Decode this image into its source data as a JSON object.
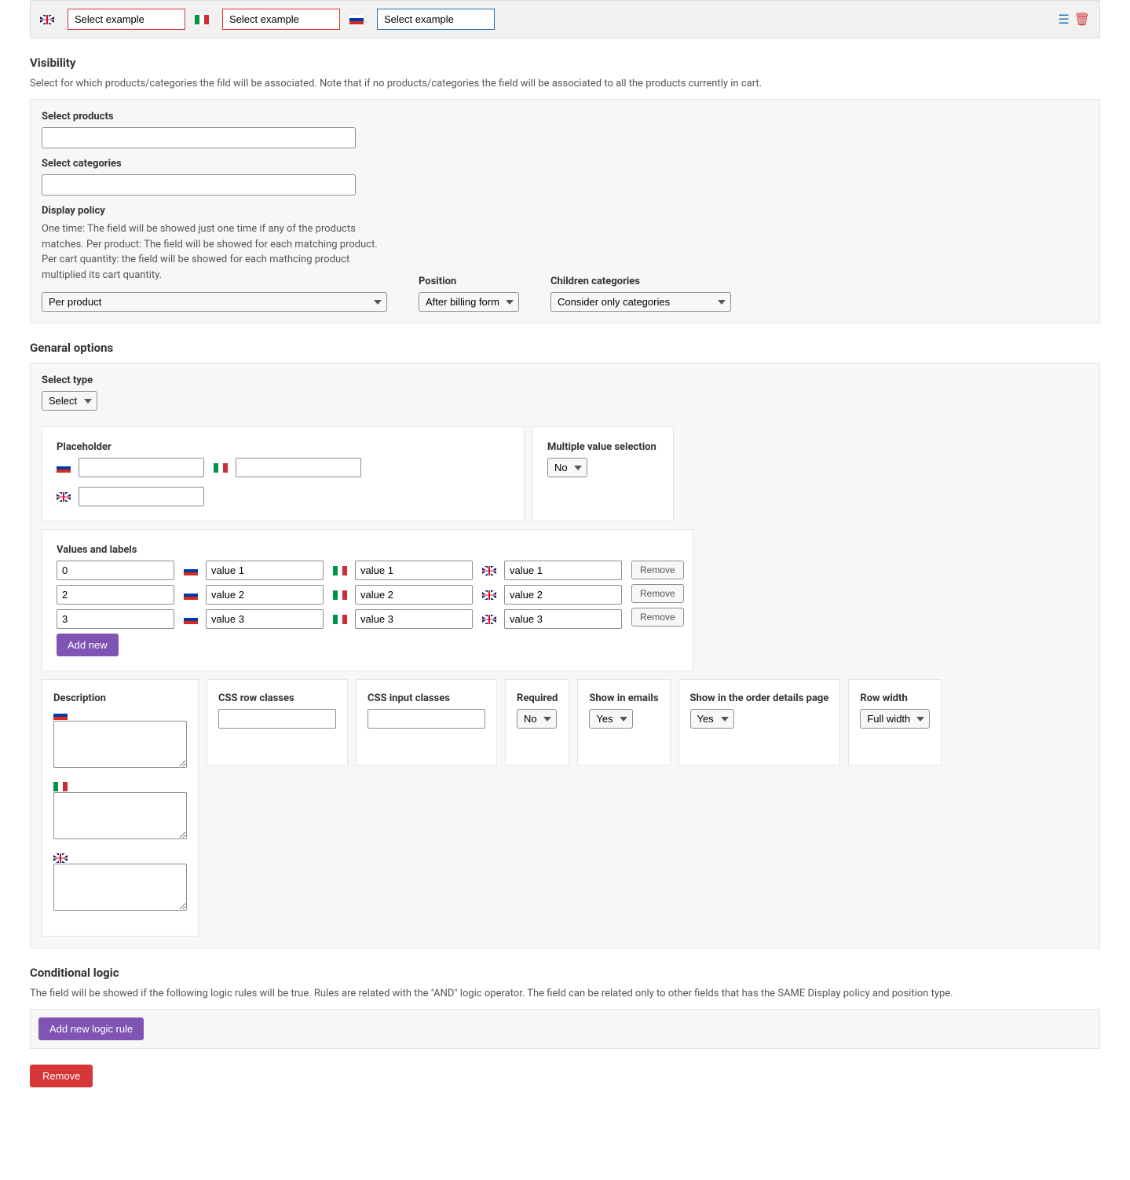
{
  "topbar": {
    "uk": "Select example",
    "it": "Select example",
    "ru": "Select example"
  },
  "visibility": {
    "heading": "Visibility",
    "desc": "Select for which products/categories the fild will be associated. Note that if no products/categories the field will be associated to all the products currently in cart.",
    "select_products": "Select products",
    "select_categories": "Select categories",
    "display_policy": "Display policy",
    "policy_desc": "One time: The field will be showed just one time if any of the products matches. Per product: The field will be showed for each matching product. Per cart quantity: the field will be showed for each mathcing product multiplied its cart quantity.",
    "policy_value": "Per product",
    "position_label": "Position",
    "position_value": "After billing form",
    "children_label": "Children categories",
    "children_value": "Consider only categories"
  },
  "general": {
    "heading": "Genaral options",
    "select_type_label": "Select type",
    "select_type_value": "Select",
    "placeholder_label": "Placeholder",
    "multiple_label": "Multiple value selection",
    "multiple_value": "No",
    "values_labels": "Values and labels",
    "rows": [
      {
        "num": "0",
        "ru": "value 1",
        "it": "value 1",
        "uk": "value 1"
      },
      {
        "num": "2",
        "ru": "value 2",
        "it": "value 2",
        "uk": "value 2"
      },
      {
        "num": "3",
        "ru": "value 3",
        "it": "value 3",
        "uk": "value 3"
      }
    ],
    "remove": "Remove",
    "add_new": "Add new",
    "description_label": "Description",
    "css_row": "CSS row classes",
    "css_input": "CSS input classes",
    "required_label": "Required",
    "required_value": "No",
    "emails_label": "Show in emails",
    "emails_value": "Yes",
    "order_label": "Show in the order details page",
    "order_value": "Yes",
    "row_width_label": "Row width",
    "row_width_value": "Full width"
  },
  "conditional": {
    "heading": "Conditional logic",
    "desc": "The field will be showed if the following logic rules will be true. Rules are related with the \"AND\" logic operator. The field can be related only to other fields that has the SAME Display policy and position type.",
    "add_rule": "Add new logic rule",
    "remove": "Remove"
  }
}
